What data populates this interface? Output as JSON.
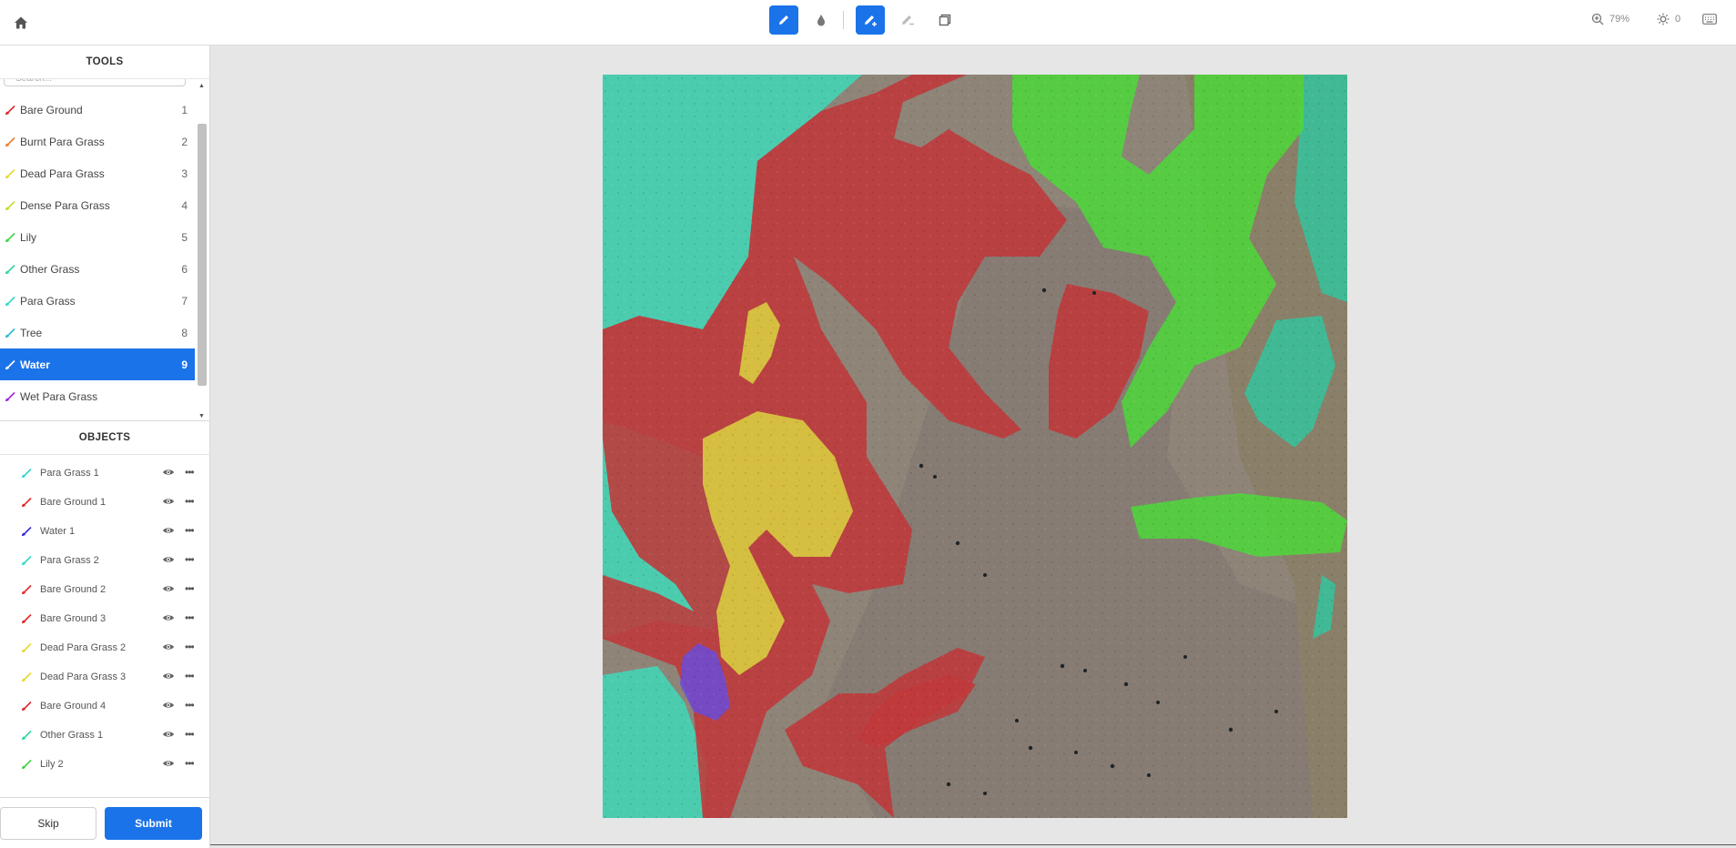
{
  "toolbar": {
    "zoom": "79%",
    "brightness": "0"
  },
  "tools_panel": {
    "title": "TOOLS",
    "search_placeholder": "Search...",
    "items": [
      {
        "label": "Bare Ground",
        "key": "1",
        "color": "#e0282e"
      },
      {
        "label": "Burnt Para Grass",
        "key": "2",
        "color": "#f07a2a"
      },
      {
        "label": "Dead Para Grass",
        "key": "3",
        "color": "#e6d832"
      },
      {
        "label": "Dense Para Grass",
        "key": "4",
        "color": "#c8d82a"
      },
      {
        "label": "Lily",
        "key": "5",
        "color": "#3fd24a"
      },
      {
        "label": "Other Grass",
        "key": "6",
        "color": "#2ed6a0"
      },
      {
        "label": "Para Grass",
        "key": "7",
        "color": "#30d8c8"
      },
      {
        "label": "Tree",
        "key": "8",
        "color": "#2eb8d0"
      },
      {
        "label": "Water",
        "key": "9",
        "color": "#ffffff",
        "selected": true
      },
      {
        "label": "Wet Para Grass",
        "key": "",
        "color": "#a028d8"
      }
    ]
  },
  "objects_panel": {
    "title": "OBJECTS",
    "items": [
      {
        "label": "Para Grass 1",
        "color": "#30d8c8"
      },
      {
        "label": "Bare Ground 1",
        "color": "#e0282e"
      },
      {
        "label": "Water 1",
        "color": "#3a2ad8"
      },
      {
        "label": "Para Grass 2",
        "color": "#30d8c8"
      },
      {
        "label": "Bare Ground 2",
        "color": "#e0282e"
      },
      {
        "label": "Bare Ground 3",
        "color": "#e0282e"
      },
      {
        "label": "Dead Para Grass 2",
        "color": "#e6d832"
      },
      {
        "label": "Dead Para Grass 3",
        "color": "#e6d832"
      },
      {
        "label": "Bare Ground 4",
        "color": "#e0282e"
      },
      {
        "label": "Other Grass 1",
        "color": "#2ed6a0"
      },
      {
        "label": "Lily 2",
        "color": "#3fd24a"
      }
    ]
  },
  "footer": {
    "skip_label": "Skip",
    "submit_label": "Submit"
  },
  "colors": {
    "accent": "#1a73e8",
    "bare_ground_overlay": "#c0383a",
    "para_grass_overlay": "#40d8b8",
    "lily_overlay": "#4cd83a",
    "dead_para_grass_overlay": "#d8cc40",
    "water_overlay": "#6a4cd8"
  }
}
